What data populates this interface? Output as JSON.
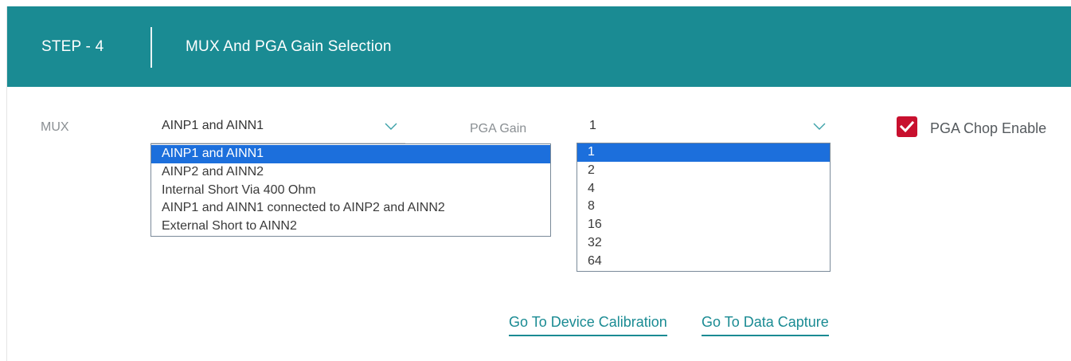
{
  "header": {
    "step": "STEP - 4",
    "title": "MUX And PGA Gain Selection"
  },
  "mux": {
    "label": "MUX",
    "selected": "AINP1 and AINN1",
    "options": [
      "AINP1 and AINN1",
      "AINP2 and AINN2",
      "Internal Short Via 400 Ohm",
      "AINP1 and AINN1 connected to AINP2 and AINN2",
      "External Short to AINN2"
    ],
    "highlighted_index": 0
  },
  "pga_gain": {
    "label": "PGA Gain",
    "selected": "1",
    "options": [
      "1",
      "2",
      "4",
      "8",
      "16",
      "32",
      "64"
    ],
    "highlighted_index": 0
  },
  "pga_chop": {
    "label": "PGA Chop Enable",
    "checked": true
  },
  "links": {
    "device_calibration": "Go To Device Calibration",
    "data_capture": "Go To Data Capture"
  },
  "colors": {
    "header_bg": "#1a8b93",
    "accent": "#1a8b93",
    "checkbox": "#c8102e",
    "list_highlight": "#1c6fdc"
  }
}
